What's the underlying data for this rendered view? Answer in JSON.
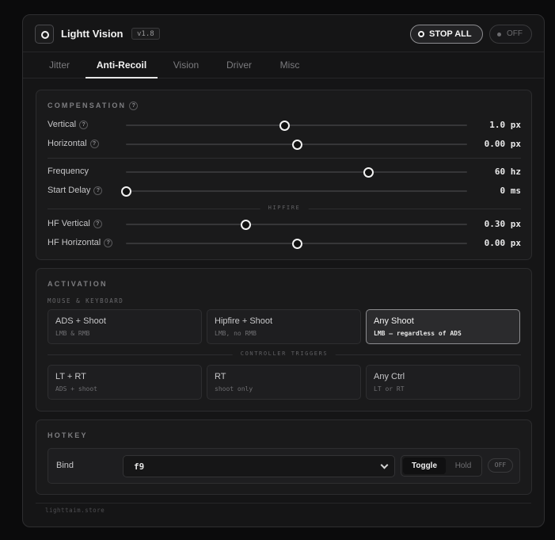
{
  "header": {
    "title": "Lightt Vision",
    "version": "v1.8",
    "stop_all_label": "STOP ALL",
    "off_label": "OFF"
  },
  "tabs": [
    {
      "label": "Jitter",
      "active": false
    },
    {
      "label": "Anti-Recoil",
      "active": true
    },
    {
      "label": "Vision",
      "active": false
    },
    {
      "label": "Driver",
      "active": false
    },
    {
      "label": "Misc",
      "active": false
    }
  ],
  "compensation": {
    "title": "COMPENSATION",
    "help": "?",
    "rows": [
      {
        "label": "Vertical",
        "help": "?",
        "value": "1.0 px",
        "fraction": 0.465
      },
      {
        "label": "Horizontal",
        "help": "?",
        "value": "0.00 px",
        "fraction": 0.5
      },
      {
        "label": "Frequency",
        "value": "60 hz",
        "fraction": 0.71
      },
      {
        "label": "Start Delay",
        "help": "?",
        "value": "0 ms",
        "fraction": 0.0
      },
      {
        "label": "HF Vertical",
        "help": "?",
        "value": "0.30 px",
        "fraction": 0.35
      },
      {
        "label": "HF Horizontal",
        "help": "?",
        "value": "0.00 px",
        "fraction": 0.5
      }
    ],
    "hipfire_divider": "HIPFIRE"
  },
  "activation": {
    "title": "ACTIVATION",
    "mk_subtitle": "MOUSE & KEYBOARD",
    "controller_divider": "CONTROLLER TRIGGERS",
    "options": [
      {
        "title": "ADS + Shoot",
        "sub": "LMB & RMB",
        "active": false
      },
      {
        "title": "Hipfire + Shoot",
        "sub": "LMB, no RMB",
        "active": false
      },
      {
        "title": "Any Shoot",
        "sub": "LMB — regardless of ADS",
        "active": true
      },
      {
        "title": "LT + RT",
        "sub": "ADS + shoot",
        "active": false
      },
      {
        "title": "RT",
        "sub": "shoot only",
        "active": false
      },
      {
        "title": "Any Ctrl",
        "sub": "LT or RT",
        "active": false
      }
    ]
  },
  "hotkey": {
    "title": "HOTKEY",
    "bind_label": "Bind",
    "bind_value": "f9",
    "mode_toggle": "Toggle",
    "mode_hold": "Hold",
    "active_mode": "Toggle",
    "off_label": "OFF"
  },
  "footer": "lighttaim.store",
  "icons": {
    "logo": "logo-ring-icon",
    "stop": "stop-circle-icon",
    "off": "status-dot-icon",
    "help": "help-circle-icon",
    "dropdown": "chevron-down-icon"
  }
}
